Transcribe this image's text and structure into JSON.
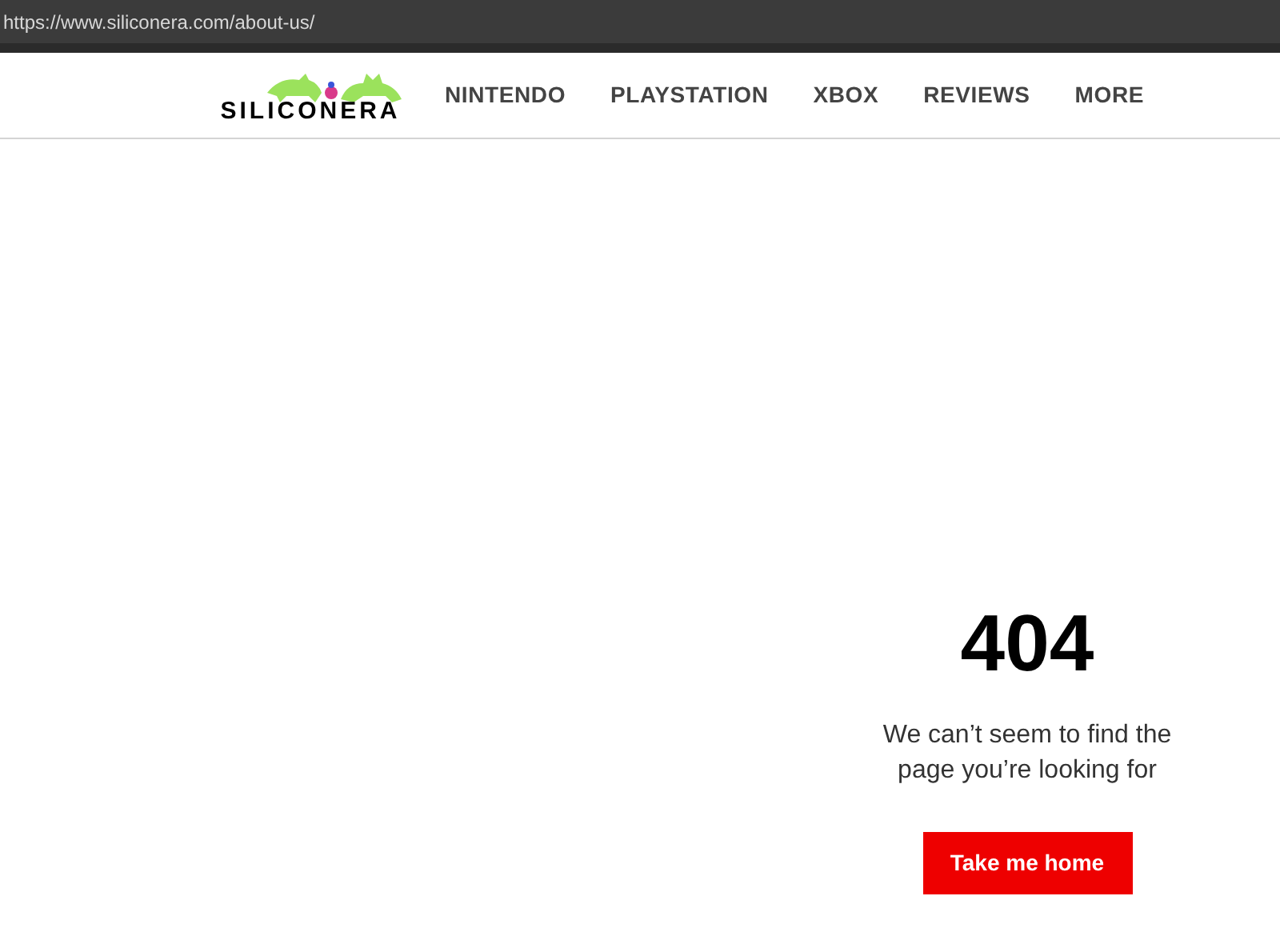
{
  "address_bar": {
    "url": "https://www.siliconera.com/about-us/"
  },
  "header": {
    "logo": "SILICONERA",
    "nav": [
      "NINTENDO",
      "PLAYSTATION",
      "XBOX",
      "REVIEWS",
      "MORE"
    ]
  },
  "error": {
    "code": "404",
    "message": "We can’t seem to find the page you’re looking for",
    "button": "Take me home"
  }
}
